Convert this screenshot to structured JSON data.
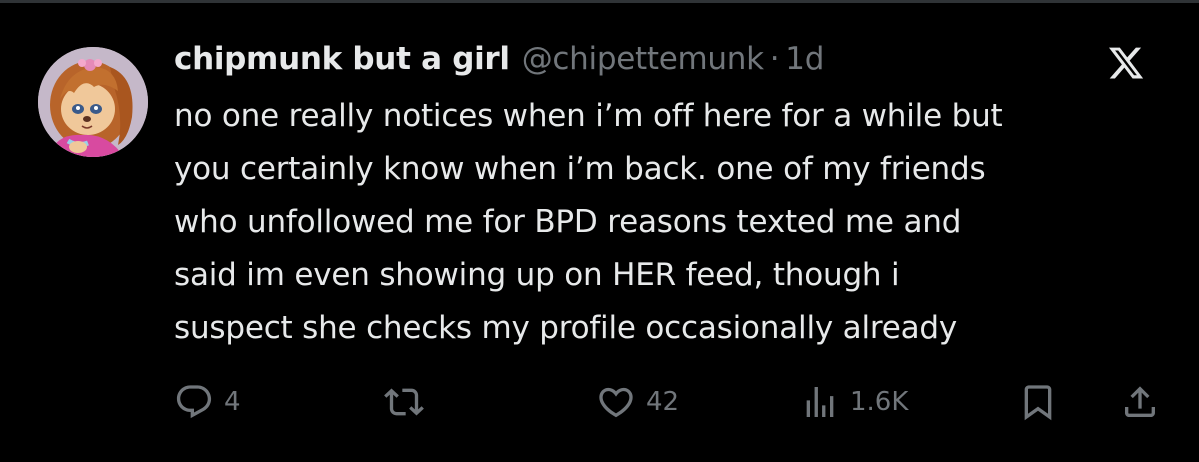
{
  "tweet": {
    "display_name": "chipmunk but a girl",
    "handle": "@chipettemunk",
    "separator": "·",
    "time": "1d",
    "text_lines": [
      "no one really notices when i’m off here for a while but",
      "you certainly know when i’m back. one of my friends",
      "who unfollowed me for BPD reasons texted me and",
      "said im even showing up on HER feed, though i",
      "suspect she checks my profile occasionally already"
    ]
  },
  "actions": {
    "reply": {
      "icon": "reply-icon",
      "count": "4"
    },
    "retweet": {
      "icon": "retweet-icon",
      "count": ""
    },
    "like": {
      "icon": "heart-icon",
      "count": "42"
    },
    "views": {
      "icon": "views-icon",
      "count": "1.6K"
    },
    "bookmark": {
      "icon": "bookmark-icon"
    },
    "share": {
      "icon": "share-icon"
    }
  },
  "logo": {
    "icon": "x-logo-icon"
  },
  "colors": {
    "background": "#000000",
    "text_primary": "#e7e9ea",
    "text_secondary": "#71767b",
    "divider": "#2f3336"
  }
}
